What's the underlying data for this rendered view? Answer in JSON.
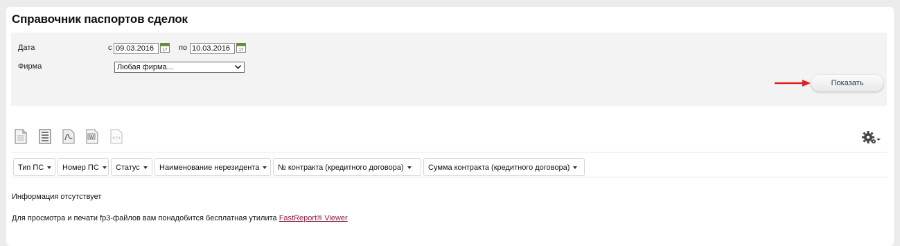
{
  "page": {
    "title": "Справочник паспортов сделок"
  },
  "filter": {
    "date_label": "Дата",
    "from_prefix": "с",
    "from_value": "09.03.2016",
    "to_prefix": "по",
    "to_value": "10.03.2016",
    "calendar_day": "17",
    "firm_label": "Фирма",
    "firm_value": "Любая фирма...",
    "show_button": "Показать"
  },
  "toolbar": {
    "icons": [
      "document-icon",
      "list-document-icon",
      "pdf-icon",
      "word-icon",
      "xml-code-icon",
      "settings-gear-icon"
    ]
  },
  "columns": [
    {
      "label": "Тип ПС"
    },
    {
      "label": "Номер ПС"
    },
    {
      "label": "Статус"
    },
    {
      "label": "Наименование нерезидента"
    },
    {
      "label": "№ контракта (кредитного договора)"
    },
    {
      "label": "Сумма контракта (кредитного договора)"
    }
  ],
  "messages": {
    "empty": "Информация отсутствует",
    "viewer_text": "Для просмотра и печати fp3-файлов вам понадобится бесплатная утилита",
    "viewer_link": "FastReport® Viewer"
  },
  "colors": {
    "accent_arrow": "#e02020",
    "link": "#8b1a3a",
    "filter_bg": "#f3f3f3"
  }
}
